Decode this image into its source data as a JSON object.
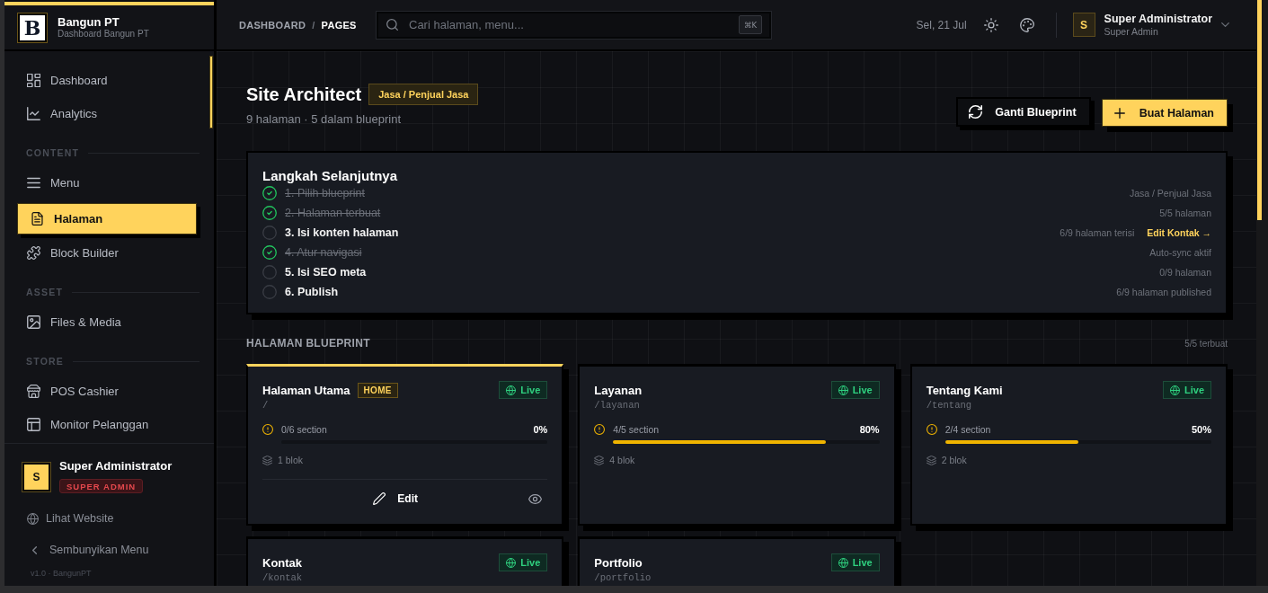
{
  "brand": {
    "logo_letter": "B",
    "name": "Bangun PT",
    "subtitle": "Dashboard Bangun PT"
  },
  "sidebar": {
    "sections": [
      {
        "items": [
          {
            "label": "Dashboard",
            "selected": false
          },
          {
            "label": "Analytics",
            "selected": false
          }
        ]
      },
      {
        "title": "CONTENT",
        "items": [
          {
            "label": "Menu",
            "selected": false
          },
          {
            "label": "Halaman",
            "selected": true
          },
          {
            "label": "Block Builder",
            "selected": false
          }
        ]
      },
      {
        "title": "ASSET",
        "items": [
          {
            "label": "Files & Media",
            "selected": false
          }
        ]
      },
      {
        "title": "STORE",
        "items": [
          {
            "label": "POS Cashier",
            "selected": false
          },
          {
            "label": "Monitor Pelanggan",
            "selected": false
          }
        ]
      }
    ],
    "user": {
      "initial": "S",
      "name": "Super Administrator",
      "role": "SUPER ADMIN"
    },
    "links": [
      "Lihat Website",
      "Sembunyikan Menu"
    ],
    "version": "v1.0 · BangunPT"
  },
  "header": {
    "breadcrumb": [
      {
        "label": "DASHBOARD",
        "selected": false
      },
      {
        "label": "PAGES",
        "selected": true
      }
    ],
    "separator": "/",
    "search": {
      "placeholder": "Cari halaman, menu...",
      "shortcut": "⌘K"
    },
    "date": "Sel, 21 Jul",
    "user": {
      "initial": "S",
      "name": "Super Administrator",
      "role": "Super Admin"
    }
  },
  "page": {
    "title": "Site Architect",
    "badge": "Jasa / Penjual Jasa",
    "subtitle": "9 halaman · 5 dalam blueprint",
    "buttons": [
      {
        "label": "Ganti Blueprint",
        "kind": "secondary"
      },
      {
        "label": "Buat Halaman",
        "kind": "primary"
      }
    ]
  },
  "next_steps": {
    "title": "Langkah Selanjutnya",
    "steps": [
      {
        "label": "1. Pilih blueprint",
        "done": true,
        "status": "Jasa / Penjual Jasa"
      },
      {
        "label": "2. Halaman terbuat",
        "done": true,
        "status": "5/5 halaman"
      },
      {
        "label": "3. Isi konten halaman",
        "done": false,
        "status": "6/9 halaman terisi",
        "link": "Edit Kontak →"
      },
      {
        "label": "4. Atur navigasi",
        "done": true,
        "status": "Auto-sync aktif"
      },
      {
        "label": "5. Isi SEO meta",
        "done": false,
        "status": "0/9 halaman"
      },
      {
        "label": "6. Publish",
        "done": false,
        "status": "6/9 halaman published"
      }
    ]
  },
  "blueprint": {
    "title": "HALAMAN BLUEPRINT",
    "count": "5/5 terbuat",
    "pages": [
      {
        "title": "Halaman Utama",
        "tag": "HOME",
        "path": "/",
        "status": "Live",
        "live": true,
        "sections": "0/6 section",
        "percent": "0%",
        "level": 0,
        "blocks": "1 blok",
        "highlighted": true,
        "action": "Edit"
      },
      {
        "title": "Layanan",
        "path": "/layanan",
        "status": "Live",
        "live": true,
        "sections": "4/5 section",
        "percent": "80%",
        "level": 0.8,
        "blocks": "4 blok",
        "highlighted": false
      },
      {
        "title": "Tentang Kami",
        "path": "/tentang",
        "status": "Live",
        "live": true,
        "sections": "2/4 section",
        "percent": "50%",
        "level": 0.5,
        "blocks": "2 blok",
        "highlighted": false
      },
      {
        "title": "Kontak",
        "path": "/kontak",
        "status": "Live",
        "live": true,
        "highlighted": false
      },
      {
        "title": "Portfolio",
        "path": "/portfolio",
        "status": "Live",
        "live": true,
        "highlighted": false
      }
    ]
  }
}
